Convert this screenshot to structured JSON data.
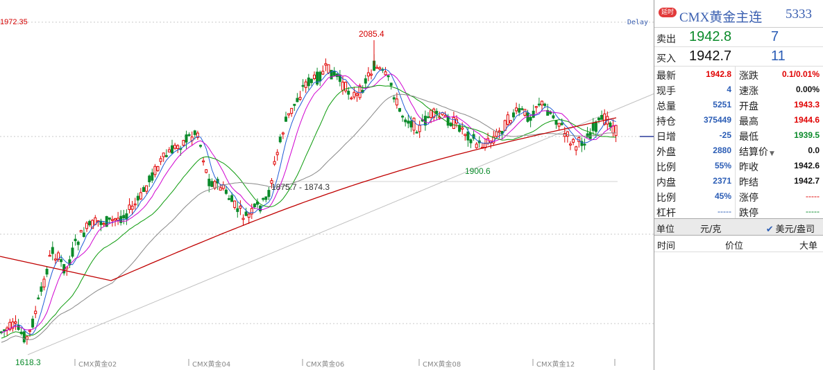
{
  "chart": {
    "top_left_price": "1972.35",
    "delay_label": "Delay",
    "x_ticks": [
      "CMX黄金02",
      "CMX黄金04",
      "CMX黄金06",
      "CMX黄金08",
      "CMX黄金12"
    ],
    "annotations": {
      "high": "2085.4",
      "low": "1618.3",
      "mid_low": "1900.6",
      "gap": "1875.7 - 1874.3"
    },
    "colors": {
      "up": "#e00000",
      "down": "#0a8a2a",
      "ma_short": "#1f5bd6",
      "ma_mid": "#d000d0",
      "ma_long": "#0a9a0a",
      "ma_longer": "#888888",
      "ma_longest": "#c00000"
    }
  },
  "panel": {
    "delay_badge": "延时",
    "title": "CMX黄金主连",
    "code": "5333",
    "sell": {
      "label": "卖出",
      "price": "1942.8",
      "volume": "7"
    },
    "buy": {
      "label": "买入",
      "price": "1942.7",
      "volume": "11"
    },
    "stats_left": [
      {
        "k": "最新",
        "v": "1942.8"
      },
      {
        "k": "现手",
        "v": "4"
      },
      {
        "k": "总量",
        "v": "5251"
      },
      {
        "k": "持仓",
        "v": "375449"
      },
      {
        "k": "日增",
        "v": "-25"
      },
      {
        "k": "外盘",
        "v": "2880"
      },
      {
        "k": "比例",
        "v": "55%"
      },
      {
        "k": "内盘",
        "v": "2371"
      },
      {
        "k": "比例",
        "v": "45%"
      },
      {
        "k": "杠杆",
        "v": "-----"
      }
    ],
    "stats_right": [
      {
        "k": "涨跌",
        "v": "0.1/0.01%"
      },
      {
        "k": "速涨",
        "v": "0.00%"
      },
      {
        "k": "开盘",
        "v": "1943.3"
      },
      {
        "k": "最高",
        "v": "1944.6"
      },
      {
        "k": "最低",
        "v": "1939.5"
      },
      {
        "k": "结算价",
        "v": "0.0"
      },
      {
        "k": "昨收",
        "v": "1942.6"
      },
      {
        "k": "昨结",
        "v": "1942.7"
      },
      {
        "k": "涨停",
        "v": "-----"
      },
      {
        "k": "跌停",
        "v": "-----"
      }
    ],
    "unit": {
      "label": "单位",
      "opt1": "元/克",
      "opt2": "美元/盎司",
      "check": "✔"
    },
    "trades": {
      "time": "时间",
      "price": "价位",
      "big": "大单"
    }
  }
}
